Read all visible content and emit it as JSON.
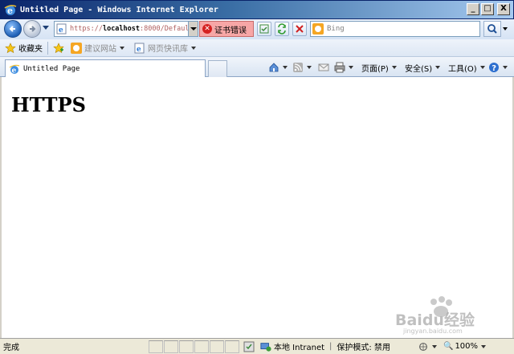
{
  "window": {
    "title": "Untitled Page - Windows Internet Explorer",
    "minimize_label": "_",
    "maximize_label": "□",
    "close_label": "X"
  },
  "address": {
    "url_scheme": "https://",
    "url_host": "localhost",
    "url_rest": ":8000/Defaul",
    "cert_error": "证书错误"
  },
  "search": {
    "placeholder": "Bing"
  },
  "favorites": {
    "label": "收藏夹",
    "items": [
      {
        "label": "建议网站"
      },
      {
        "label": "网页快讯库"
      }
    ]
  },
  "tab": {
    "label": "Untitled Page"
  },
  "commands": {
    "page": "页面(P)",
    "safety": "安全(S)",
    "tools": "工具(O)"
  },
  "content": {
    "heading": "HTTPS"
  },
  "status": {
    "text": "完成",
    "zone": "本地 Intranet",
    "protected_mode": "保护模式: 禁用",
    "zoom": "100%"
  },
  "watermark": {
    "text": "Baidu经验",
    "sub": "jingyan.baidu.com"
  }
}
